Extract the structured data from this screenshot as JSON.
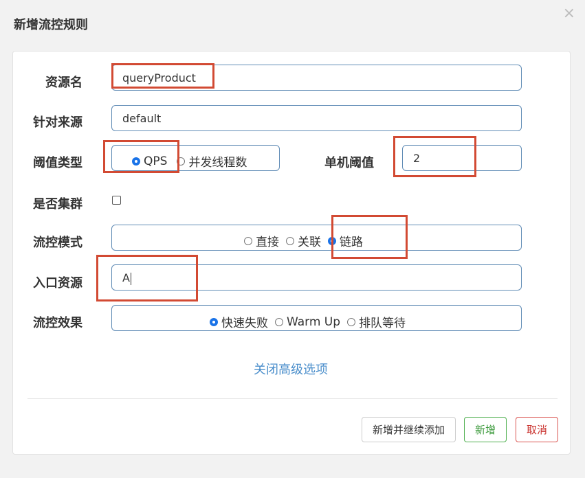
{
  "dialog": {
    "title": "新增流控规则",
    "close_label": "×"
  },
  "form": {
    "resource_label": "资源名",
    "resource_value": "queryProduct",
    "origin_label": "针对来源",
    "origin_value": "default",
    "threshold_type_label": "阈值类型",
    "threshold_type_options": [
      "QPS",
      "并发线程数"
    ],
    "threshold_type_selected": "QPS",
    "single_threshold_label": "单机阈值",
    "single_threshold_value": "2",
    "cluster_label": "是否集群",
    "cluster_checked": false,
    "flow_mode_label": "流控模式",
    "flow_mode_options": [
      "直接",
      "关联",
      "链路"
    ],
    "flow_mode_selected": "链路",
    "entry_resource_label": "入口资源",
    "entry_resource_value": "A",
    "effect_label": "流控效果",
    "effect_options": [
      "快速失败",
      "Warm Up",
      "排队等待"
    ],
    "effect_selected": "快速失败",
    "advanced_link": "关闭高级选项"
  },
  "footer": {
    "add_continue_label": "新增并继续添加",
    "add_label": "新增",
    "cancel_label": "取消"
  },
  "colors": {
    "accent": "#1a73e8",
    "field_border": "#5f8bb5",
    "highlight": "#d24a33",
    "link": "#4a8ecb",
    "success": "#4cae4c",
    "danger": "#d9534f"
  }
}
